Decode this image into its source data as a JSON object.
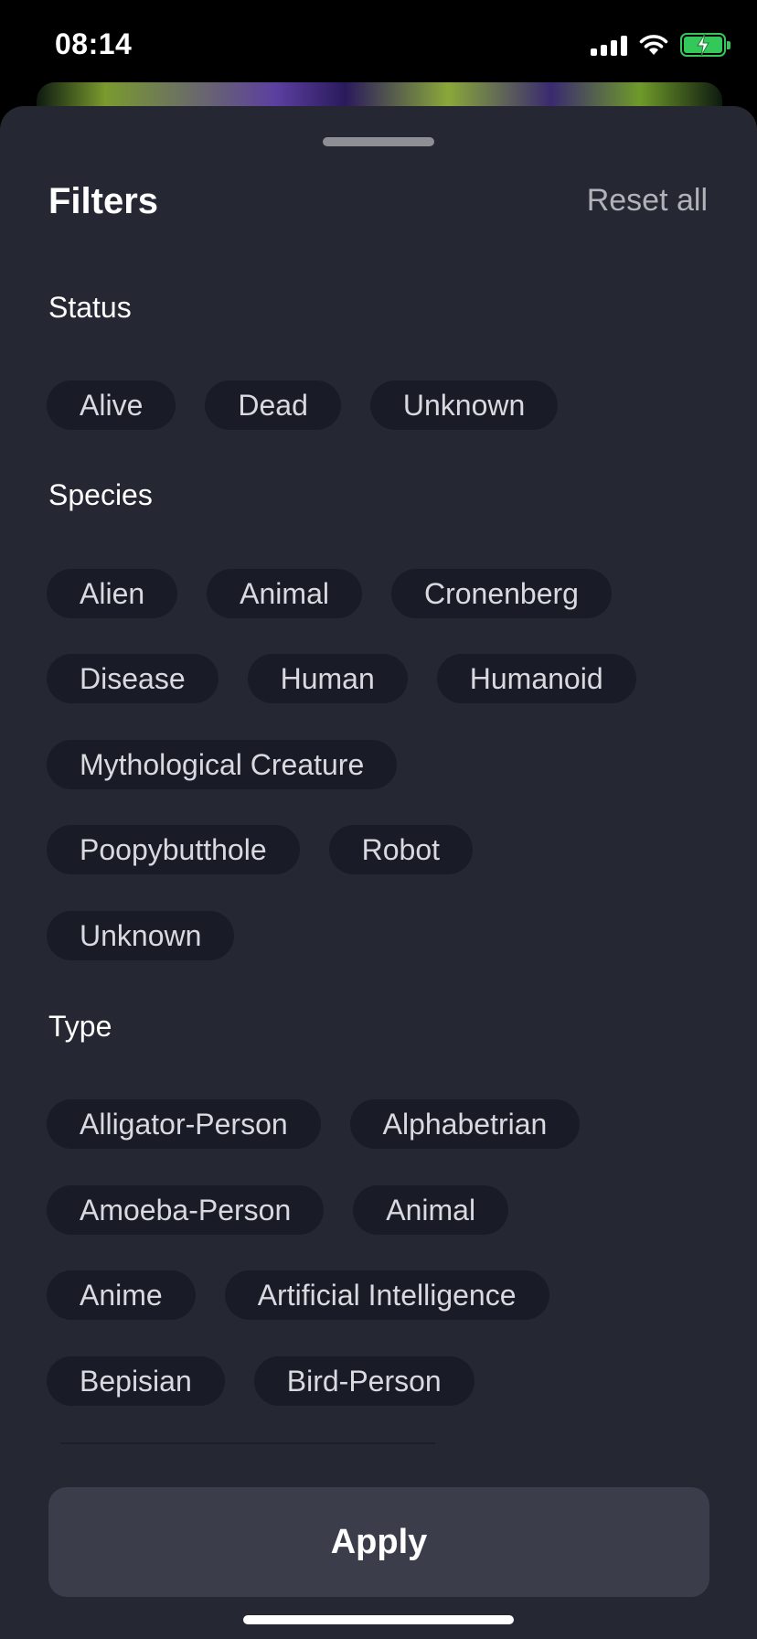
{
  "status_bar": {
    "time": "08:14",
    "signal_icon": "cellular-signal-icon",
    "wifi_icon": "wifi-icon",
    "battery_icon": "battery-charging-icon"
  },
  "sheet": {
    "title": "Filters",
    "reset_label": "Reset all"
  },
  "sections": {
    "status": {
      "title": "Status",
      "chips": [
        "Alive",
        "Dead",
        "Unknown"
      ]
    },
    "species": {
      "title": "Species",
      "chips": [
        "Alien",
        "Animal",
        "Cronenberg",
        "Disease",
        "Human",
        "Humanoid",
        "Mythological Creature",
        "Poopybutthole",
        "Robot",
        "Unknown"
      ]
    },
    "type": {
      "title": "Type",
      "chips": [
        "Alligator-Person",
        "Alphabetrian",
        "Amoeba-Person",
        "Animal",
        "Anime",
        "Artificial Intelligence",
        "Bepisian",
        "Bird-Person"
      ]
    }
  },
  "apply_label": "Apply",
  "colors": {
    "sheet_bg": "#252833",
    "chip_bg": "#191c27",
    "apply_bg": "#3b3e4a",
    "battery": "#34c759"
  }
}
